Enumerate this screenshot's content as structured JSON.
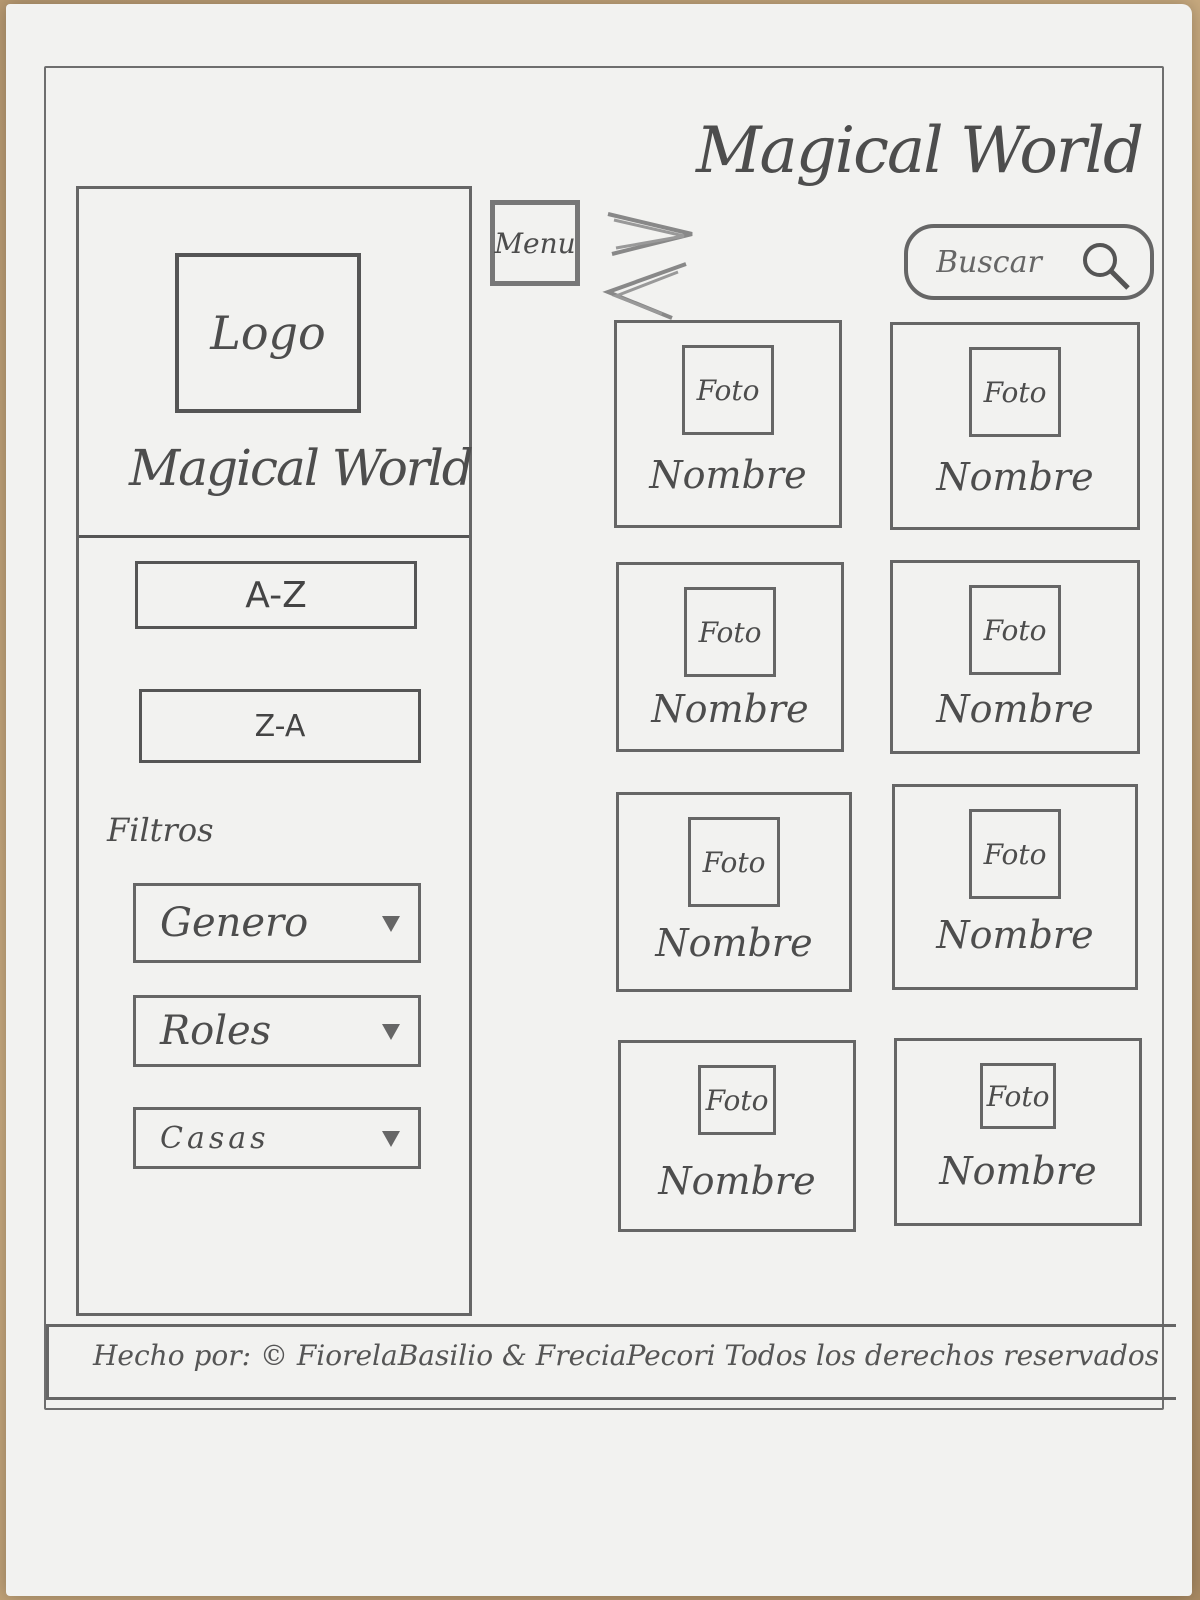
{
  "header": {
    "title": "Magical World",
    "menu_label": "Menu"
  },
  "search": {
    "placeholder": "Buscar"
  },
  "sidebar": {
    "logo_label": "Logo",
    "brand": "Magical World",
    "sort": [
      {
        "label": "A-Z"
      },
      {
        "label": "Z-A"
      }
    ],
    "filters_label": "Filtros",
    "filters": [
      {
        "label": "Genero"
      },
      {
        "label": "Roles"
      },
      {
        "label": "Casas"
      }
    ]
  },
  "cards": [
    {
      "photo": "Foto",
      "name": "Nombre"
    },
    {
      "photo": "Foto",
      "name": "Nombre"
    },
    {
      "photo": "Foto",
      "name": "Nombre"
    },
    {
      "photo": "Foto",
      "name": "Nombre"
    },
    {
      "photo": "Foto",
      "name": "Nombre"
    },
    {
      "photo": "Foto",
      "name": "Nombre"
    },
    {
      "photo": "Foto",
      "name": "Nombre"
    },
    {
      "photo": "Foto",
      "name": "Nombre"
    }
  ],
  "footer": {
    "text": "Hecho por: © FiorelaBasilio & FreciaPecori Todos los derechos reservados"
  },
  "icons": {
    "search": "search-icon",
    "dropdown": "dropdown-triangle-icon",
    "menu_arrow": "menu-arrow-icon"
  }
}
